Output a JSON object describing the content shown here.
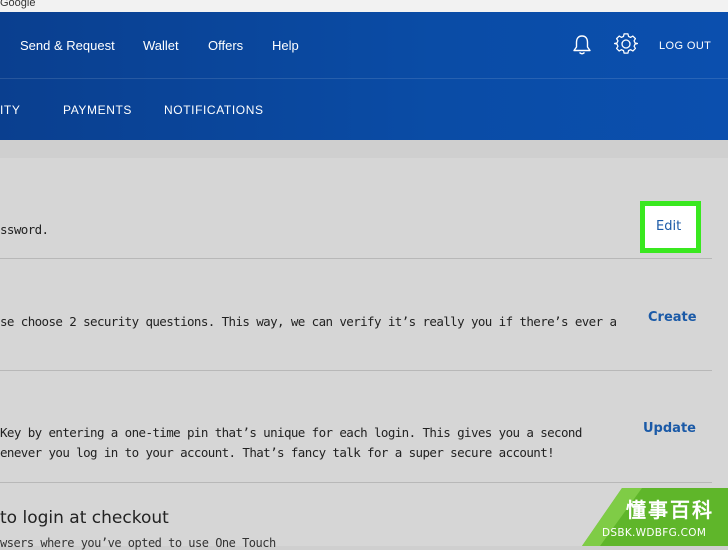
{
  "topbar": {
    "text": "Google"
  },
  "nav": {
    "items": [
      "Send & Request",
      "Wallet",
      "Offers",
      "Help"
    ],
    "logout": "LOG OUT",
    "icons": [
      "bell-icon",
      "gear-icon"
    ]
  },
  "subnav": {
    "items": [
      "ITY",
      "PAYMENTS",
      "NOTIFICATIONS"
    ]
  },
  "rows": {
    "password": {
      "text": "ssword.",
      "action": "Edit"
    },
    "questions": {
      "text": "se choose 2 security questions. This way, we can verify it’s really you if there’s ever a",
      "action": "Create"
    },
    "key": {
      "line1": "Key by entering a one-time pin that’s unique for each login. This gives you a second",
      "line2": "enever you log in to your account. That’s fancy talk for a super secure account!",
      "action": "Update"
    },
    "checkout": {
      "heading": "to login at checkout",
      "sub": "wsers where you’ve opted to use One Touch"
    }
  },
  "watermark": {
    "title": "懂事百科",
    "url": "DSBK.WDBFG.COM"
  },
  "colors": {
    "header": "#0a4ca6",
    "link": "#1b5aa7",
    "highlight": "#39e81f",
    "panel": "#d6d6d6"
  }
}
